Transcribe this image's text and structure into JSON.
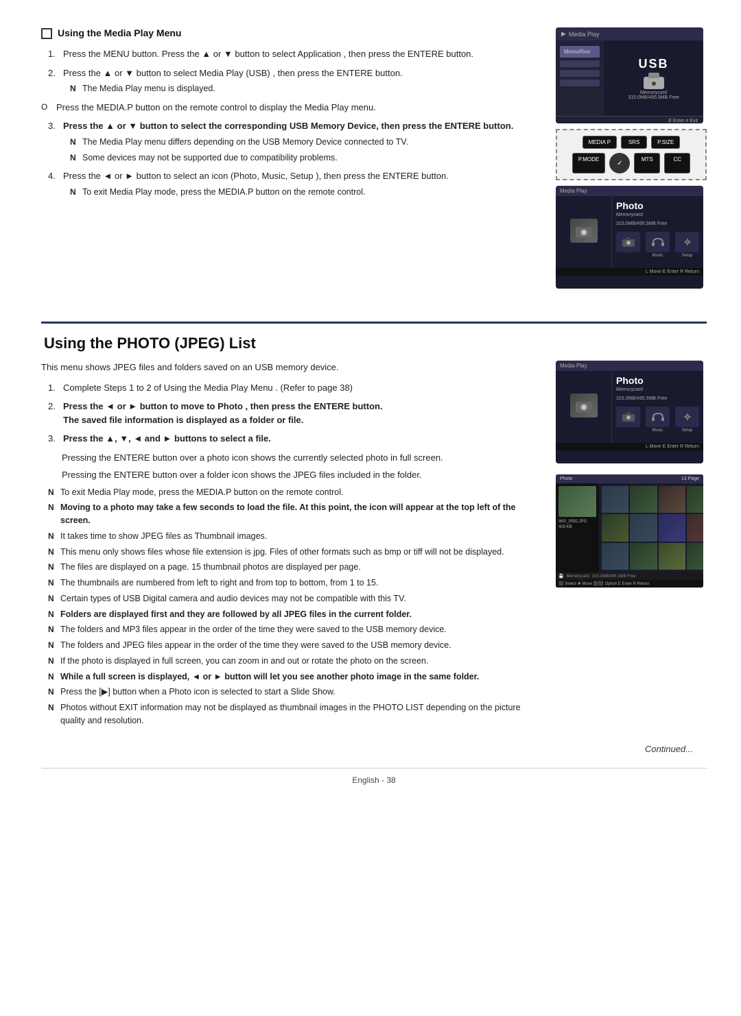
{
  "page": {
    "footer": {
      "text": "English - 38"
    },
    "continued": "Continued..."
  },
  "section1": {
    "heading": "Using the Media Play Menu",
    "steps": [
      {
        "num": "1",
        "text": "Press the MENU button. Press the ▲ or ▼ button to select Application , then press the ENTERE   button."
      },
      {
        "num": "2",
        "text": "Press the ▲ or ▼ button to select Media Play (USB) , then press the ENTERE button.",
        "note": "The Media Play  menu is displayed."
      },
      {
        "num": "3",
        "text": "Press the ▲ or ▼ button to select the corresponding USB Memory Device, then press the ENTERE   button.",
        "notes": [
          "The Media Play  menu differs depending on the USB Memory Device connected to TV.",
          "Some devices may not be supported due to compatibility problems."
        ]
      },
      {
        "num": "4",
        "text": "Press the ◄ or ► button to select an icon (Photo, Music, Setup ), then press the ENTERE   button.",
        "note": "To exit Media Play mode, press the MEDIA.P button on the remote control."
      }
    ],
    "circle_item": "Press the MEDIA.P button on the remote control to display the Media Play menu.",
    "screen1": {
      "header": "Media Play",
      "sidebar_items": [
        "MemoRive",
        "",
        "",
        ""
      ],
      "usb_label": "USB",
      "memory_text": "Memorycard",
      "memory_sub": "315.0MB/495.5MB Free",
      "footer": "E  Enter  e  Exit"
    },
    "screen2": {
      "buttons": [
        "MEDIA P",
        "SRS",
        "P.SIZE",
        "P.MODE",
        "MTS",
        "CC"
      ]
    },
    "screen3": {
      "header": "Media Play",
      "photo_title": "Photo",
      "memory_text": "Memorycard",
      "memory_sub": "315.0MB/495.5MB Free",
      "icons": [
        "camera",
        "headphones",
        "gear"
      ],
      "labels": [
        "",
        "Music",
        "Setup"
      ],
      "footer": "L  Move  E  Enter  R  Return"
    }
  },
  "section2": {
    "title": "Using the PHOTO (JPEG) List",
    "intro": "This menu shows JPEG files and folders saved on an USB memory device.",
    "steps": [
      {
        "num": "1",
        "text": "Complete Steps 1 to 2 of Using the Media Play Menu  . (Refer to page 38)"
      },
      {
        "num": "2",
        "text": "Press the ◄ or ► button to move to Photo , then press the ENTERE   button.",
        "bold_note": "The saved file information is displayed as a folder or file."
      },
      {
        "num": "3",
        "text": "Press the ▲, ▼, ◄ and ► buttons to select a file."
      }
    ],
    "indent_paras": [
      "Pressing the ENTERE   button over a photo icon shows the currently selected photo in full screen.",
      "Pressing the ENTERE   button over a folder icon shows the JPEG files included in the folder."
    ],
    "notes": [
      "To exit Media Play mode, press the MEDIA.P button on the remote control.",
      "Moving to a photo may take a few seconds to load the file. At this point, the icon will appear at the top left of the screen.",
      "It takes time to show JPEG files as Thumbnail images.",
      "This menu only shows files whose file extension is jpg. Files of other formats such as bmp or tiff will not be displayed.",
      "The files are displayed on a page. 15 thumbnail photos are displayed per page.",
      "The thumbnails are numbered from left to right and from top to bottom, from 1 to 15.",
      "Certain types of USB Digital camera and audio devices may not be compatible with this TV.",
      "Folders are displayed first and they are followed by all JPEG files in the current folder.",
      "The folders and MP3 files appear in the order of the time they were saved to the USB memory device.",
      "The folders and JPEG files appear in the order of the time they were saved to the USB memory device.",
      "If the photo is displayed in full screen, you can zoom in and out or rotate the photo on the screen.",
      "While a full screen is displayed, ◄ or ► button will let you see another photo image in the same folder.",
      "Press the [▶] button when a Photo icon is selected to start a Slide Show.",
      "Photos without EXIT information may not be displayed as thumbnail images in the PHOTO LIST depending on the picture quality and resolution."
    ],
    "screen_photo": {
      "header": "Media Play",
      "photo_title": "Photo",
      "memory_text": "Memorycard",
      "memory_sub": "315.0MB/495.5MB Free",
      "icons": [
        "camera",
        "headphones",
        "gear"
      ],
      "labels": [
        "",
        "Music",
        "Setup"
      ],
      "footer": "L  Move  E  Enter  R  Return"
    },
    "screen_list": {
      "header": "Photo",
      "filename": "IMG_0592.JPG",
      "size": "409 KB",
      "page": "13 Page",
      "footer": "⬛ Select  ❖ Move  ⬛⬛ Option  E  Enter  R  Return",
      "memory_label": "Memorycard",
      "memory_sub": "315.0MB/495.5MB Free"
    }
  }
}
